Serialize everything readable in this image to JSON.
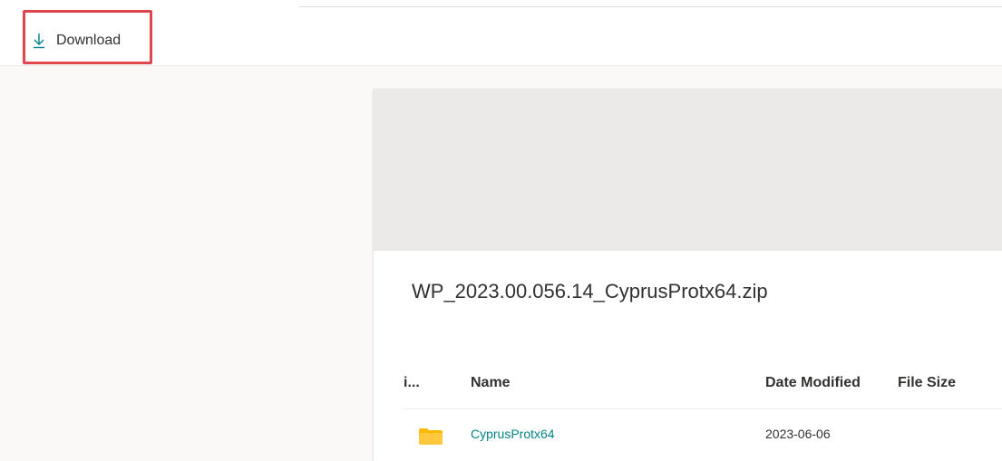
{
  "toolbar": {
    "download_label": "Download",
    "download_icon": "download-icon",
    "highlight_color": "#e0464f"
  },
  "file": {
    "name": "WP_2023.00.056.14_CyprusProtx64.zip"
  },
  "table": {
    "columns": [
      "i...",
      "Name",
      "Date Modified",
      "File Size"
    ],
    "rows": [
      {
        "icon": "folder-icon",
        "name": "CyprusProtx64",
        "date_modified": "2023-06-06",
        "file_size": ""
      }
    ]
  },
  "colors": {
    "accent": "#038387",
    "folder": "#ffb900"
  }
}
